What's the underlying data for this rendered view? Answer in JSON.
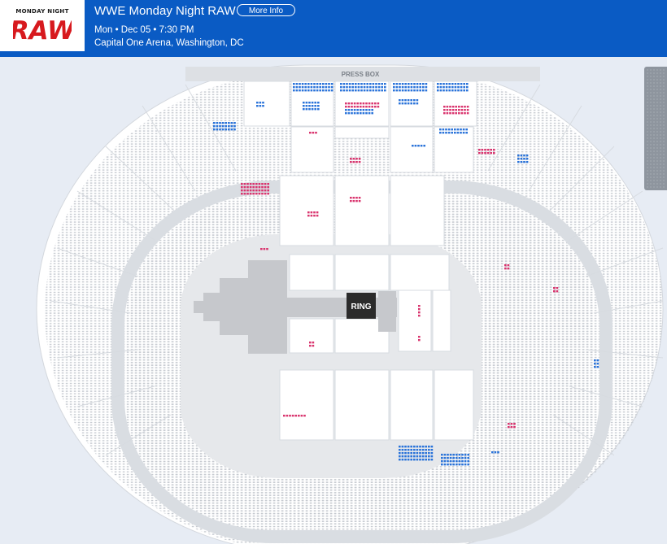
{
  "event": {
    "logo_top": "MONDAY NIGHT",
    "logo_word": "RAW",
    "title": "WWE Monday Night RAW",
    "more_info_label": "More Info",
    "date_time": "Mon • Dec 05 • 7:30 PM",
    "venue": "Capital One Arena, Washington, DC"
  },
  "map": {
    "press_box_label": "PRESS BOX",
    "ring_label": "RING"
  },
  "colors": {
    "header_bg": "#0a5bc4",
    "available_blue": "#2a73d9",
    "available_pink": "#d9346e",
    "logo_red": "#d7191e"
  }
}
